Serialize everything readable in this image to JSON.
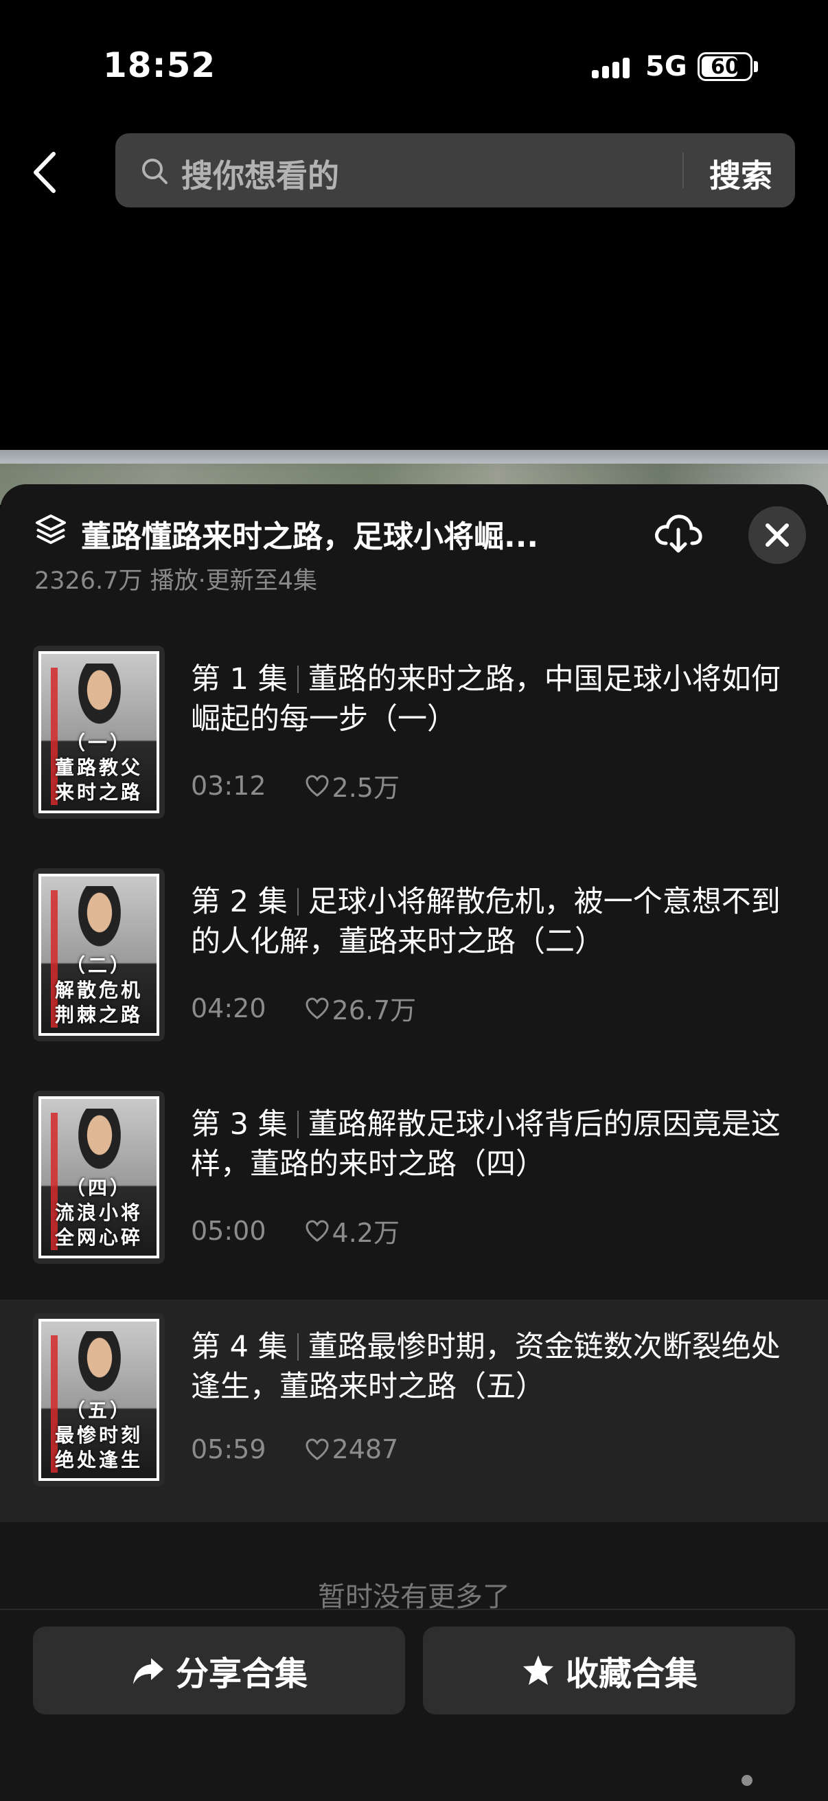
{
  "status": {
    "time": "18:52",
    "network": "5G",
    "battery": "60"
  },
  "search": {
    "placeholder": "搜你想看的",
    "button": "搜索"
  },
  "panel": {
    "title": "董路懂路来时之路，足球小将崛...",
    "meta": "2326.7万 播放·更新至4集"
  },
  "episodes": [
    {
      "num": "第 1 集",
      "title": "董路的来时之路，中国足球小将如何崛起的每一步（一）",
      "duration": "03:12",
      "likes": "2.5万",
      "thumb_text": [
        "（一）",
        "董路教父",
        "来时之路"
      ]
    },
    {
      "num": "第 2 集",
      "title": "足球小将解散危机，被一个意想不到的人化解，董路来时之路（二）",
      "duration": "04:20",
      "likes": "26.7万",
      "thumb_text": [
        "（二）",
        "解散危机",
        "荆棘之路"
      ]
    },
    {
      "num": "第 3 集",
      "title": "董路解散足球小将背后的原因竟是这样，董路的来时之路（四）",
      "duration": "05:00",
      "likes": "4.2万",
      "thumb_text": [
        "（四）",
        "流浪小将",
        "全网心碎"
      ]
    },
    {
      "num": "第 4 集",
      "title": "董路最惨时期，资金链数次断裂绝处逢生，董路来时之路（五）",
      "duration": "05:59",
      "likes": "2487",
      "thumb_text": [
        "（五）",
        "最惨时刻",
        "绝处逢生"
      ]
    }
  ],
  "footer": {
    "no_more": "暂时没有更多了",
    "share": "分享合集",
    "favorite": "收藏合集"
  }
}
